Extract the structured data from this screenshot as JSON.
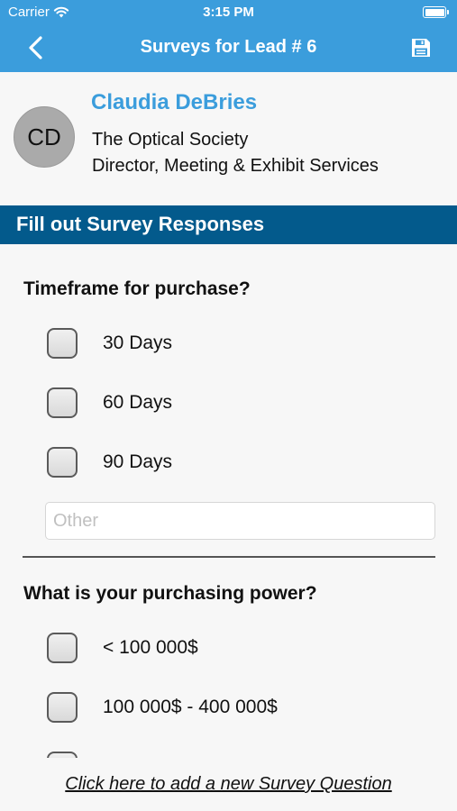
{
  "status_bar": {
    "carrier": "Carrier",
    "time": "3:15 PM"
  },
  "nav": {
    "title": "Surveys for Lead # 6"
  },
  "contact": {
    "initials": "CD",
    "name": "Claudia DeBries",
    "company": "The Optical Society",
    "position": "Director, Meeting & Exhibit Services"
  },
  "section": {
    "title": "Fill out Survey Responses"
  },
  "questions": [
    {
      "text": "Timeframe for purchase?",
      "options": [
        "30 Days",
        "60 Days",
        "90 Days"
      ],
      "other_placeholder": "Other"
    },
    {
      "text": "What is your purchasing power?",
      "options": [
        "< 100 000$",
        "100 000$ - 400 000$"
      ]
    }
  ],
  "footer": {
    "add_question_link": "Click here to add a new Survey Question"
  },
  "colors": {
    "nav": "#3b9ddc",
    "section_header": "#035a8c",
    "name": "#3b9ddc"
  }
}
